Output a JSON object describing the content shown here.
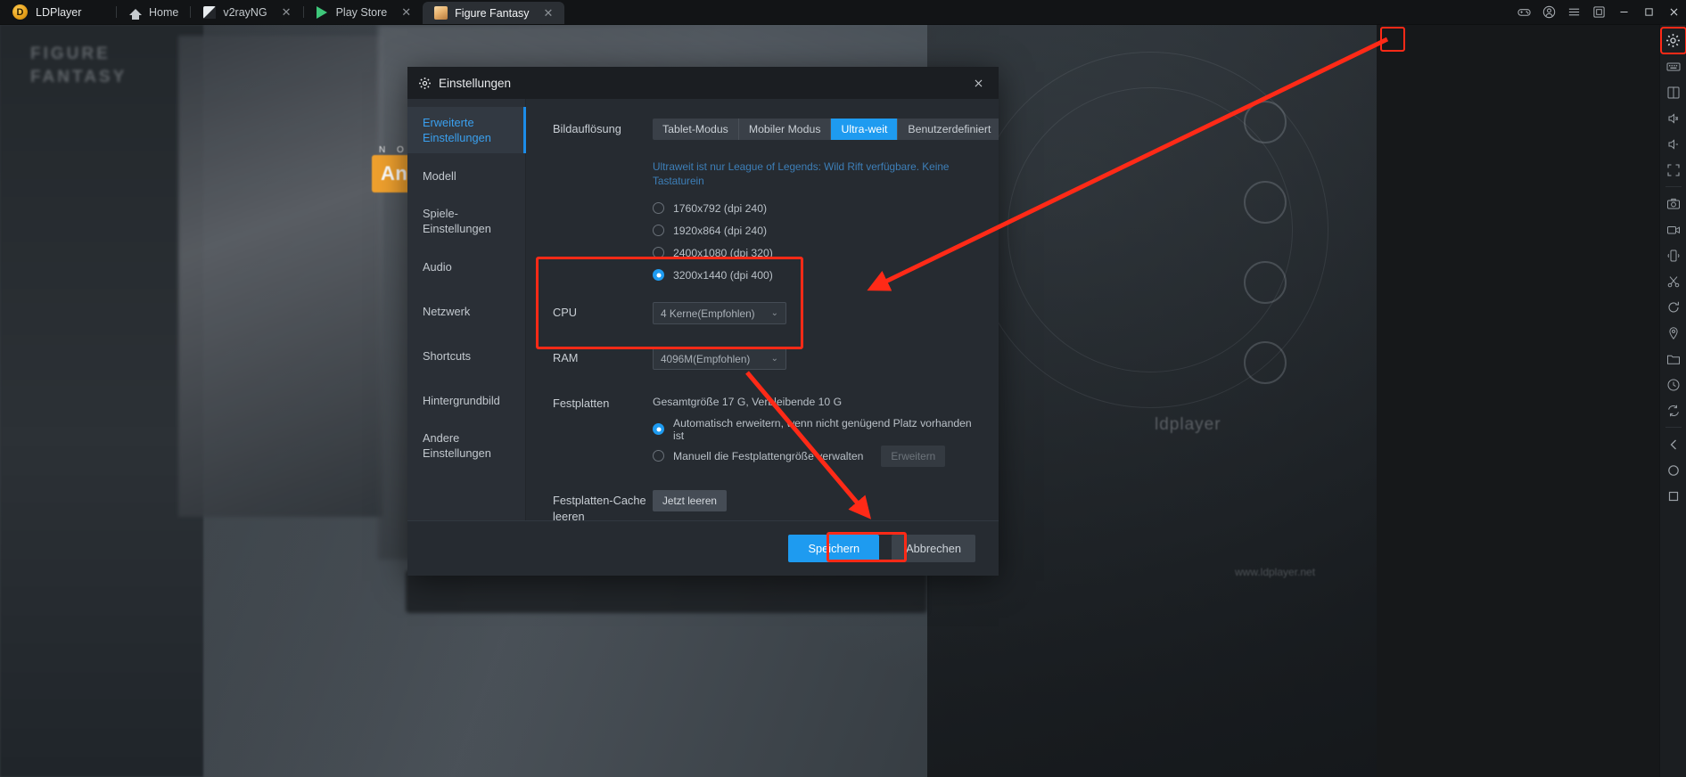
{
  "titlebar": {
    "brand": "LDPlayer",
    "brand_logo_glyph": "D",
    "tabs": [
      {
        "label": "Home",
        "icon": "home-icon",
        "closable": false,
        "active": false
      },
      {
        "label": "v2rayNG",
        "icon": "v2rayng-icon",
        "closable": true,
        "active": false
      },
      {
        "label": "Play Store",
        "icon": "play-store-icon",
        "closable": true,
        "active": false
      },
      {
        "label": "Figure Fantasy",
        "icon": "figure-fantasy-icon",
        "closable": true,
        "active": true
      }
    ],
    "window_buttons": [
      {
        "name": "gamepad-icon"
      },
      {
        "name": "account-icon"
      },
      {
        "name": "menu-icon"
      },
      {
        "name": "multi-instance-icon"
      },
      {
        "name": "minimize-icon"
      },
      {
        "name": "maximize-icon"
      },
      {
        "name": "close-icon"
      }
    ]
  },
  "right_toolbar": {
    "items": [
      "settings-gear-icon",
      "keyboard-mapping-icon",
      "multi-instance-icon",
      "volume-up-icon",
      "volume-down-icon",
      "fullscreen-icon",
      "screenshot-icon",
      "video-record-icon",
      "shake-icon",
      "scissors-icon",
      "rotate-icon",
      "location-icon",
      "file-manager-icon",
      "operation-recorder-icon",
      "synchronizer-icon",
      "back-icon",
      "home-icon",
      "recents-icon"
    ],
    "highlighted_index": 0
  },
  "background": {
    "game_title_lines": [
      "FIGURE",
      "FANTASY"
    ],
    "no_label": "N  O",
    "orange_chip": "Ann",
    "watermark": "ldplayer",
    "watermark2": "www.ldplayer.net"
  },
  "dialog": {
    "title": "Einstellungen",
    "gear_icon": "gear-icon",
    "close_icon": "close-icon",
    "sidebar": [
      {
        "label": "Erweiterte Einstellungen",
        "active": true
      },
      {
        "label": "Modell",
        "active": false
      },
      {
        "label": "Spiele-Einstellungen",
        "active": false
      },
      {
        "label": "Audio",
        "active": false
      },
      {
        "label": "Netzwerk",
        "active": false
      },
      {
        "label": "Shortcuts",
        "active": false
      },
      {
        "label": "Hintergrundbild",
        "active": false
      },
      {
        "label": "Andere Einstellungen",
        "active": false
      }
    ],
    "resolution": {
      "label": "Bildauflösung",
      "modes": [
        {
          "label": "Tablet-Modus",
          "active": false
        },
        {
          "label": "Mobiler Modus",
          "active": false
        },
        {
          "label": "Ultra-weit",
          "active": true
        },
        {
          "label": "Benutzerdefiniert",
          "active": false
        }
      ],
      "hint": "Ultraweit ist nur League of Legends: Wild Rift verfügbare. Keine Tastaturein",
      "options": [
        {
          "label": "1760x792  (dpi 240)",
          "selected": false
        },
        {
          "label": "1920x864  (dpi 240)",
          "selected": false
        },
        {
          "label": "2400x1080  (dpi 320)",
          "selected": false
        },
        {
          "label": "3200x1440  (dpi 400)",
          "selected": true
        }
      ]
    },
    "cpu": {
      "label": "CPU",
      "value": "4 Kerne(Empfohlen)",
      "caret": "chevron-down-icon"
    },
    "ram": {
      "label": "RAM",
      "value": "4096M(Empfohlen)",
      "caret": "chevron-down-icon"
    },
    "disk": {
      "label": "Festplatten",
      "info": "Gesamtgröße 17 G,  Verbleibende 10 G",
      "options": [
        {
          "label": "Automatisch erweitern, wenn nicht genügend Platz vorhanden ist",
          "selected": true
        },
        {
          "label": "Manuell die Festplattengröße verwalten",
          "selected": false
        }
      ],
      "expand_button": "Erweitern"
    },
    "cache": {
      "label": "Festplatten-Cache leeren",
      "button": "Jetzt leeren"
    },
    "footer": {
      "save": "Speichern",
      "cancel": "Abbrechen"
    }
  },
  "annotations": {
    "accent_color": "#ff2a17",
    "boxes": [
      {
        "name": "cpu-ram-highlight"
      },
      {
        "name": "save-button-highlight"
      },
      {
        "name": "settings-gear-highlight"
      }
    ],
    "arrows": [
      {
        "name": "arrow-to-cpu-ram"
      },
      {
        "name": "arrow-to-save-button"
      }
    ]
  }
}
